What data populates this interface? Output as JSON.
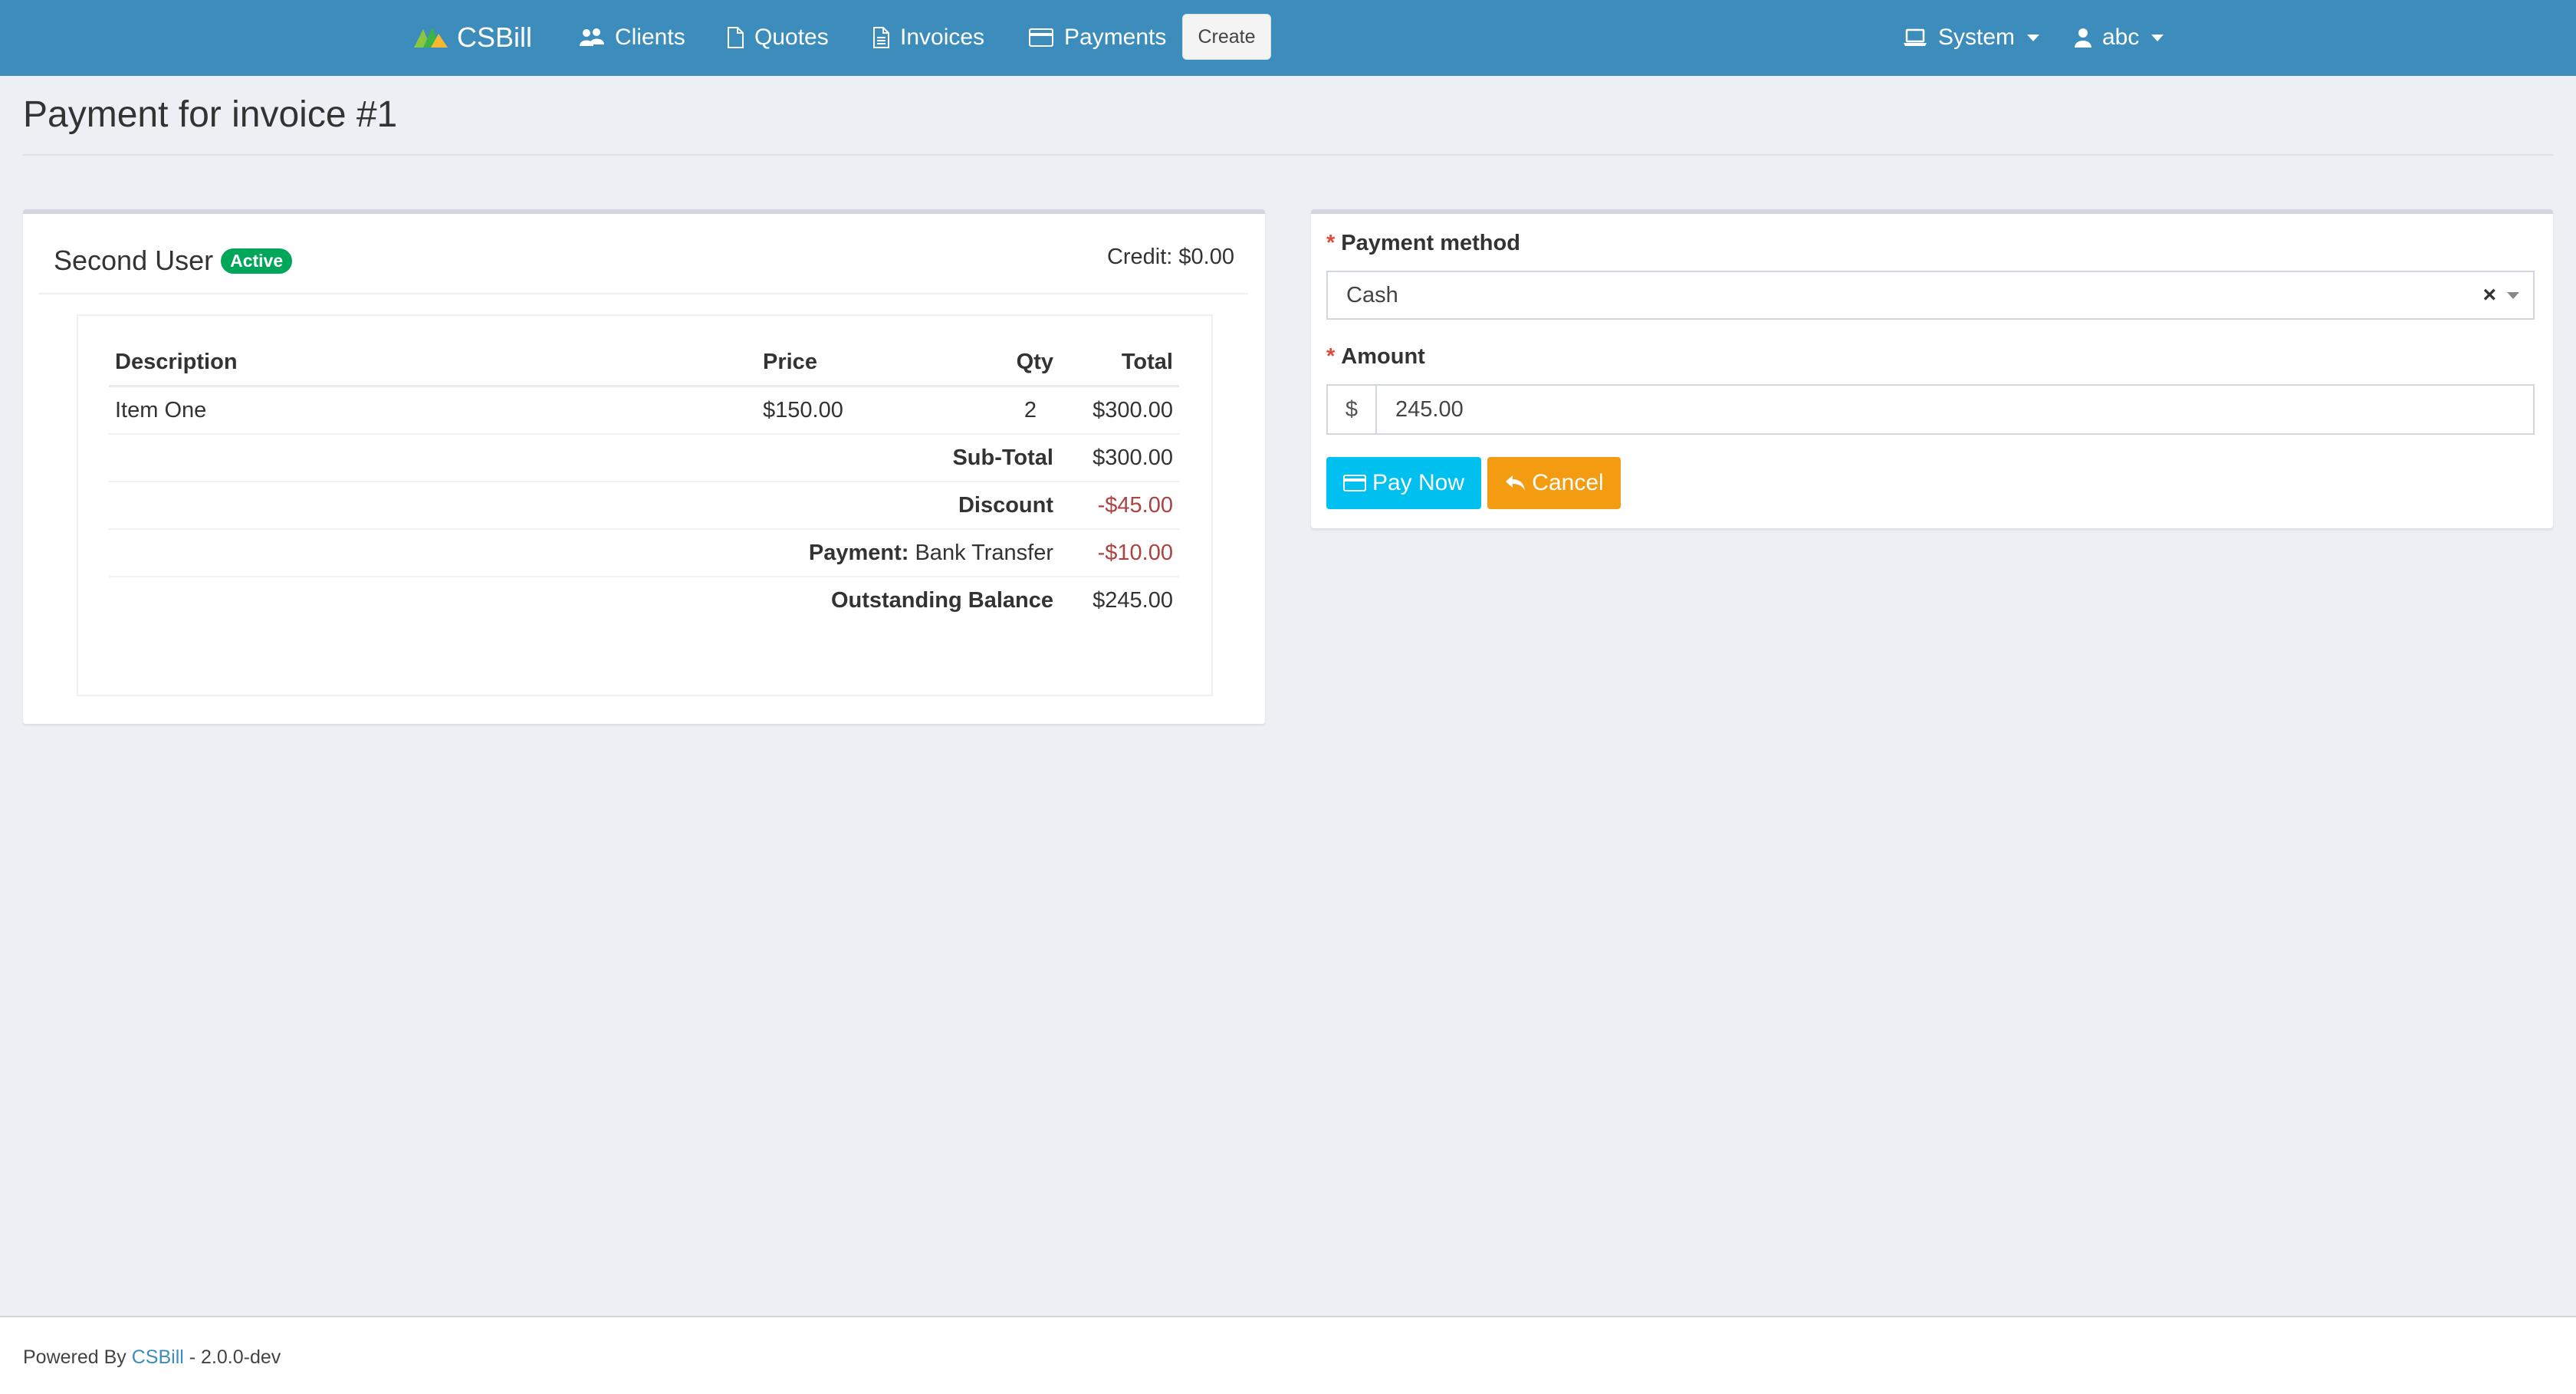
{
  "navbar": {
    "brand": "CSBill",
    "items": [
      {
        "label": "Clients",
        "icon": "users-icon"
      },
      {
        "label": "Quotes",
        "icon": "file-icon"
      },
      {
        "label": "Invoices",
        "icon": "file-text-icon"
      },
      {
        "label": "Payments",
        "icon": "credit-card-icon"
      }
    ],
    "create_label": "Create",
    "system_label": "System",
    "user_label": "abc"
  },
  "page": {
    "title": "Payment for invoice #1"
  },
  "client": {
    "name": "Second User",
    "status": "Active",
    "credit": "Credit: $0.00"
  },
  "invoice": {
    "columns": [
      "Description",
      "Price",
      "Qty",
      "Total"
    ],
    "rows": [
      {
        "description": "Item One",
        "price": "$150.00",
        "qty": "2",
        "total": "$300.00"
      }
    ],
    "subtotal_label": "Sub-Total",
    "subtotal_value": "$300.00",
    "discount_label": "Discount",
    "discount_value": "-$45.00",
    "payment_label": "Payment:",
    "payment_method": "Bank Transfer",
    "payment_value": "-$10.00",
    "balance_label": "Outstanding Balance",
    "balance_value": "$245.00"
  },
  "form": {
    "required_marker": "*",
    "method_label": "Payment method",
    "method_value": "Cash",
    "clear_symbol": "×",
    "amount_label": "Amount",
    "currency_symbol": "$",
    "amount_value": "245.00",
    "pay_label": "Pay Now",
    "cancel_label": "Cancel"
  },
  "footer": {
    "prefix": "Powered By",
    "link": "CSBill",
    "version": "- 2.0.0-dev"
  },
  "colors": {
    "navbar": "#3c8dbc",
    "success_badge": "#00a65a",
    "pay_button": "#00c0ef",
    "cancel_button": "#f39c12",
    "negative_amount": "#a94442",
    "required_marker": "#dd4b39"
  }
}
